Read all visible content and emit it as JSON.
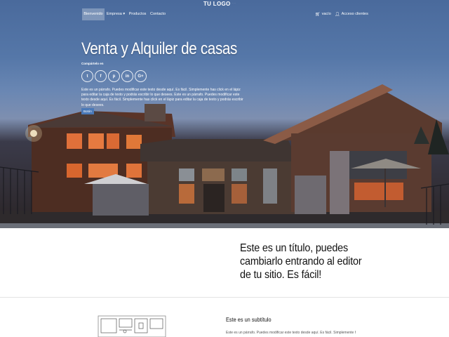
{
  "nav": {
    "items": [
      {
        "label": "Bienvenido",
        "active": true
      },
      {
        "label": "Empresa ▾",
        "active": false
      },
      {
        "label": "Productos",
        "active": false
      },
      {
        "label": "Contacto",
        "active": false
      }
    ],
    "logo": "TU LOGO",
    "cart_label": "vacío",
    "client_label": "Acceso clientes"
  },
  "hero": {
    "title": "Venta y Alquiler de casas",
    "share_label": "Compártelo en",
    "social": [
      "twitter-icon",
      "facebook-icon",
      "pinterest-icon",
      "linkedin-icon",
      "google-plus-icon"
    ],
    "social_glyphs": [
      "t",
      "f",
      "p",
      "in",
      "G+"
    ],
    "paragraph": "Este es un párrafo. Puedes modificar este texto desde aquí. Es fácil. Simplemente has click en el lápiz para editar la caja de texto y podrás escribir lo que desees. Este es un párrafo. Puedes modificar este texto desde aquí. Es fácil. Simplemente has click en el lápiz para editar la caja de texto y podrás escribir lo que desees.",
    "button_label": "Botón"
  },
  "section2": {
    "heading": "Este es un título, puedes cambiarlo entrando al editor de tu sitio. Es fácil!"
  },
  "section3": {
    "subtitle": "Este es un subtítulo",
    "paragraph": "Este es un párrafo. Puedes modificar este texto desde aquí. Es fácil. Simplemente has click"
  },
  "colors": {
    "sky_top": "#4a6a9c",
    "button_blue": "#4a79b8",
    "window_glow": "#d9622e"
  }
}
